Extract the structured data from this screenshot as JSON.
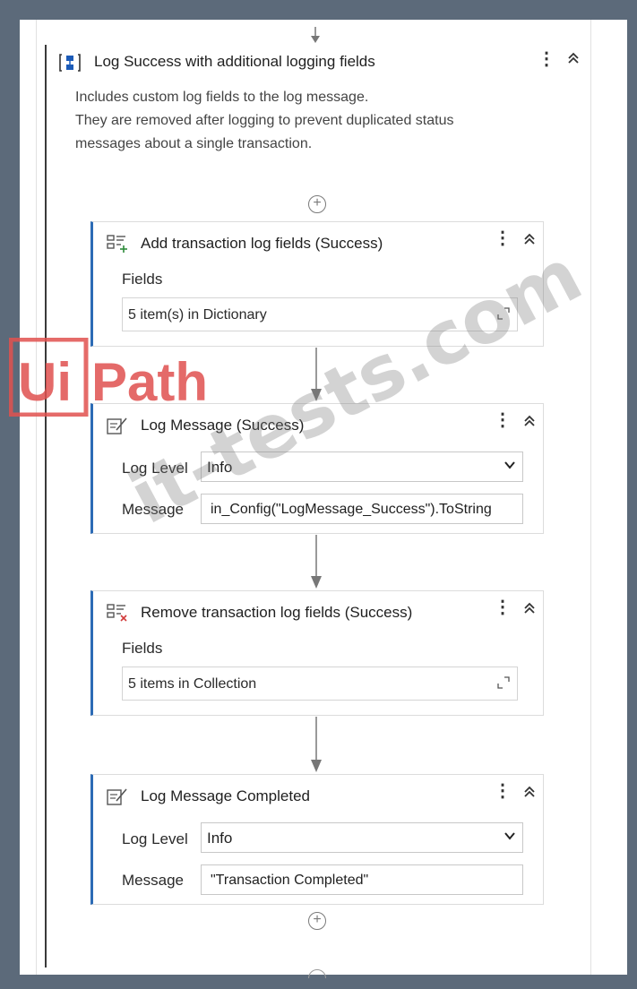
{
  "sequence": {
    "title": "Log Success with additional logging fields",
    "description": [
      "Includes custom log fields to the log message.",
      "They are removed after logging to prevent duplicated status",
      "messages about a single transaction."
    ]
  },
  "activities": [
    {
      "title": "Add transaction log fields (Success)",
      "field_label": "Fields",
      "field_value": "5 item(s) in Dictionary"
    },
    {
      "title": "Log Message (Success)",
      "log_level_label": "Log Level",
      "log_level_value": "Info",
      "message_label": "Message",
      "message_value": "in_Config(\"LogMessage_Success\").ToString"
    },
    {
      "title": "Remove transaction log fields (Success)",
      "field_label": "Fields",
      "field_value": "5 items in Collection"
    },
    {
      "title": "Log Message Completed",
      "log_level_label": "Log Level",
      "log_level_value": "Info",
      "message_label": "Message",
      "message_value": "\"Transaction Completed\""
    }
  ],
  "watermark": {
    "brand_left": "Ui",
    "brand_right": "Path",
    "site": "it-tests.com"
  },
  "icons": {
    "sequence": "sequence-icon",
    "add_fields": "add-log-fields-icon",
    "log_message": "log-message-icon",
    "remove_fields": "remove-log-fields-icon"
  },
  "colors": {
    "accent": "#2c6bb5",
    "watermark_red": "#e0514f",
    "background": "#5c6a7a"
  }
}
